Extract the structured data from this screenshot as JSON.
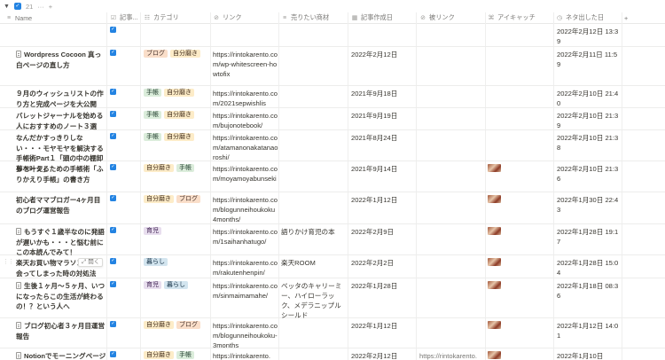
{
  "group": {
    "count": "21",
    "more": "···",
    "add": "+"
  },
  "columns": {
    "name": "Name",
    "check": "記事...",
    "category": "カテゴリ",
    "link": "リンク",
    "product": "売りたい商材",
    "created": "記事作成日",
    "backlink": "被リンク",
    "eyecatch": "アイキャッチ",
    "idea_date": "ネタ出した日",
    "add": "+"
  },
  "tag_colors": {
    "ブログ": {
      "bg": "#fadec9",
      "fg": "#44312a"
    },
    "自分磨き": {
      "bg": "#fdecc8",
      "fg": "#402c1b"
    },
    "手帳": {
      "bg": "#dbeddb",
      "fg": "#1c3829"
    },
    "育児": {
      "bg": "#e8deee",
      "fg": "#412454"
    },
    "暮らし": {
      "bg": "#d3e5ef",
      "fg": "#183347"
    }
  },
  "open_label": "開く",
  "rows": [
    {
      "name": "",
      "doc": false,
      "checked": true,
      "tags": [],
      "link": "",
      "product": "",
      "created": "",
      "backlink": "",
      "eyecatch": false,
      "idea_date": "2022年2月12日 13:39"
    },
    {
      "name": "Wordpress Cocoon 真っ白ページの直し方",
      "doc": true,
      "checked": true,
      "tags": [
        "ブログ",
        "自分磨き"
      ],
      "link": "https://rintokarento.com/wp-whitescreen-howtofix",
      "product": "",
      "created": "2022年2月12日",
      "backlink": "",
      "eyecatch": false,
      "idea_date": "2022年2月11日 11:59"
    },
    {
      "name": "９月のウィッシュリストの作り方と完成ページを大公開",
      "doc": false,
      "checked": true,
      "tags": [
        "手帳",
        "自分磨き"
      ],
      "link": "https://rintokarento.com/2021sepwishlis",
      "product": "",
      "created": "2021年9月18日",
      "backlink": "",
      "eyecatch": false,
      "idea_date": "2022年2月10日 21:40"
    },
    {
      "name": "バレットジャーナルを始める人におすすめのノート３選",
      "doc": false,
      "checked": true,
      "tags": [
        "手帳",
        "自分磨き"
      ],
      "link": "https://rintokarento.com/bujonotebook/",
      "product": "",
      "created": "2021年9月19日",
      "backlink": "",
      "eyecatch": false,
      "idea_date": "2022年2月10日 21:39"
    },
    {
      "name": "なんだかすっきりしない・・・モヤモヤを解決する手帳術Part１「頭の中の棚卸しページ」",
      "doc": false,
      "checked": true,
      "tags": [
        "手帳",
        "自分磨き"
      ],
      "link": "https://rintokarento.com/atamanonakatanaoroshi/",
      "product": "",
      "created": "2021年8月24日",
      "backlink": "",
      "eyecatch": false,
      "idea_date": "2022年2月10日 21:38"
    },
    {
      "name": "夢を叶えるための手帳術「ふりかえり手帳」の書き方",
      "doc": false,
      "checked": true,
      "tags": [
        "自分磨き",
        "手帳"
      ],
      "link": "https://rintokarento.com/moyamoyabunseki",
      "product": "",
      "created": "2021年9月14日",
      "backlink": "",
      "eyecatch": true,
      "idea_date": "2022年2月10日 21:36"
    },
    {
      "name": "初心者ママブロガー4ヶ月目のブログ運営報告",
      "doc": false,
      "checked": true,
      "tags": [
        "自分磨き",
        "ブログ"
      ],
      "link": "https://rintokarento.com/blogunneihoukoku4months/",
      "product": "",
      "created": "2022年1月12日",
      "backlink": "",
      "eyecatch": true,
      "idea_date": "2022年1月30日 22:43"
    },
    {
      "name": "もうすぐ１歳半なのに発語が遅いかも・・・と悩む前にこの本読んでみて！",
      "doc": true,
      "checked": true,
      "tags": [
        "育児"
      ],
      "link": "https://rintokarento.com/1saihanhatugo/",
      "product": "語りかけ育児の本",
      "created": "2022年2月9日",
      "backlink": "",
      "eyecatch": true,
      "idea_date": "2022年1月28日 19:17"
    },
    {
      "name": "楽天お買い物マラソンで?出会ってしまった時の対処法",
      "doc": false,
      "checked": true,
      "tags": [
        "暮らし"
      ],
      "link": "https://rintokarento.com/rakutenhenpin/",
      "product": "楽天ROOM",
      "created": "2022年2月2日",
      "backlink": "",
      "eyecatch": true,
      "idea_date": "2022年1月28日 15:04",
      "hover": true
    },
    {
      "name": "生後１ヶ月〜５ヶ月、いつになったらこの生活が終わるの！？という人へ",
      "doc": true,
      "checked": true,
      "tags": [
        "育児",
        "暮らし"
      ],
      "link": "https://rintokarento.com/sinmaimamahe/",
      "product": "ベッタのキャリーミー、ハイローラック、メデラニップルシールド",
      "created": "2022年1月28日",
      "backlink": "",
      "eyecatch": true,
      "idea_date": "2022年1月18日 08:36"
    },
    {
      "name": "ブログ初心者３ヶ月目運営報告",
      "doc": true,
      "checked": true,
      "tags": [
        "自分磨き",
        "ブログ"
      ],
      "link": "https://rintokarento.com/blogunneihoukoku-3months",
      "product": "",
      "created": "2022年1月12日",
      "backlink": "",
      "eyecatch": true,
      "idea_date": "2022年1月12日 14:01"
    },
    {
      "name": "Notionでモーニングページを",
      "doc": true,
      "checked": true,
      "tags": [
        "自分磨き",
        "手帳"
      ],
      "link": "https://rintokarento.",
      "product": "",
      "created": "2022年2月12日",
      "backlink": "https://rintokarento.",
      "eyecatch": true,
      "idea_date": "2022年1月10日"
    }
  ]
}
